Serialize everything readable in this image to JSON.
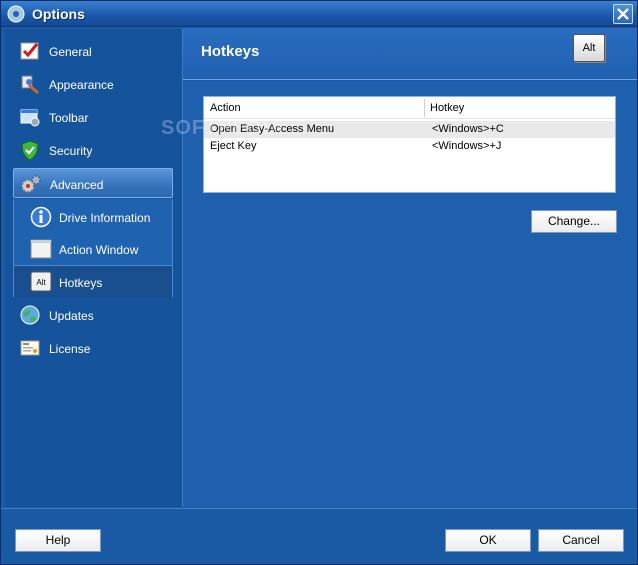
{
  "window": {
    "title": "Options"
  },
  "sidebar": {
    "items": [
      {
        "label": "General",
        "icon": "general-icon"
      },
      {
        "label": "Appearance",
        "icon": "appearance-icon"
      },
      {
        "label": "Toolbar",
        "icon": "toolbar-icon"
      },
      {
        "label": "Security",
        "icon": "security-icon"
      },
      {
        "label": "Advanced",
        "icon": "advanced-icon",
        "selected": true
      },
      {
        "label": "Updates",
        "icon": "updates-icon"
      },
      {
        "label": "License",
        "icon": "license-icon"
      }
    ],
    "subitems": [
      {
        "label": "Drive Information",
        "icon": "info-icon"
      },
      {
        "label": "Action Window",
        "icon": "window-icon"
      },
      {
        "label": "Hotkeys",
        "icon": "alt-key-icon",
        "selected": true,
        "key_text": "Alt"
      }
    ]
  },
  "header": {
    "title": "Hotkeys",
    "badge": "Alt"
  },
  "table": {
    "columns": [
      "Action",
      "Hotkey"
    ],
    "rows": [
      {
        "action": "Open Easy-Access Menu",
        "hotkey": "<Windows>+C"
      },
      {
        "action": "Eject Key",
        "hotkey": "<Windows>+J"
      }
    ]
  },
  "buttons": {
    "change": "Change...",
    "help": "Help",
    "ok": "OK",
    "cancel": "Cancel"
  },
  "watermark": "SOFTPEDIA",
  "colors": {
    "accent": "#1c5aa3",
    "selected": "#3573bd"
  }
}
